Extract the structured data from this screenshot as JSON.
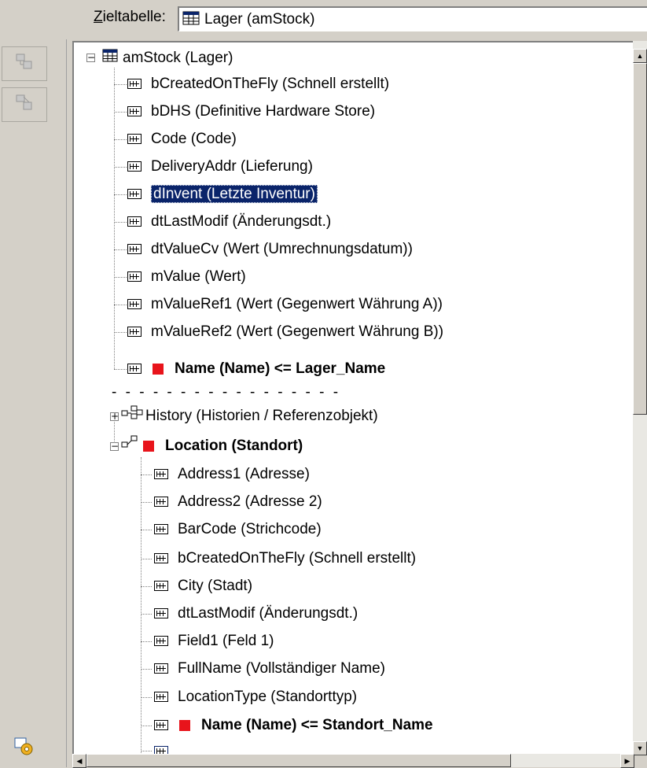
{
  "header": {
    "target_label_first": "Z",
    "target_label_rest": "ieltabelle:",
    "target_value": "Lager (amStock)"
  },
  "toolbar": {
    "buttons": [
      {
        "icon": "add-mapping-icon"
      },
      {
        "icon": "remove-mapping-icon"
      },
      {
        "icon": "settings-icon"
      }
    ]
  },
  "tree": {
    "root": "amStock (Lager)",
    "fields": [
      "bCreatedOnTheFly (Schnell erstellt)",
      "bDHS (Definitive Hardware Store)",
      "Code (Code)",
      "DeliveryAddr (Lieferung)",
      "dInvent (Letzte Inventur)",
      "dtLastModif (Änderungsdt.)",
      "dtValueCv (Wert (Umrechnungsdatum))",
      "mValue (Wert)",
      "mValueRef1 (Wert (Gegenwert Währung A))",
      "mValueRef2 (Wert (Gegenwert Währung B))",
      "Name (Name)  <=  Lager_Name"
    ],
    "separator": "- - - - - - - - - - - - - - - - -",
    "links": [
      "History (Historien / Referenzobjekt)",
      "Location (Standort)"
    ],
    "location_fields": [
      "Address1 (Adresse)",
      "Address2 (Adresse 2)",
      "BarCode (Strichcode)",
      "bCreatedOnTheFly (Schnell erstellt)",
      "City (Stadt)",
      "dtLastModif (Änderungsdt.)",
      "Field1 (Feld 1)",
      "FullName (Vollständiger Name)",
      "LocationType (Standorttyp)",
      "Name (Name)  <=  Standort_Name"
    ]
  },
  "colors": {
    "selection": "#0a246a",
    "mapped_marker": "#e8141b"
  }
}
